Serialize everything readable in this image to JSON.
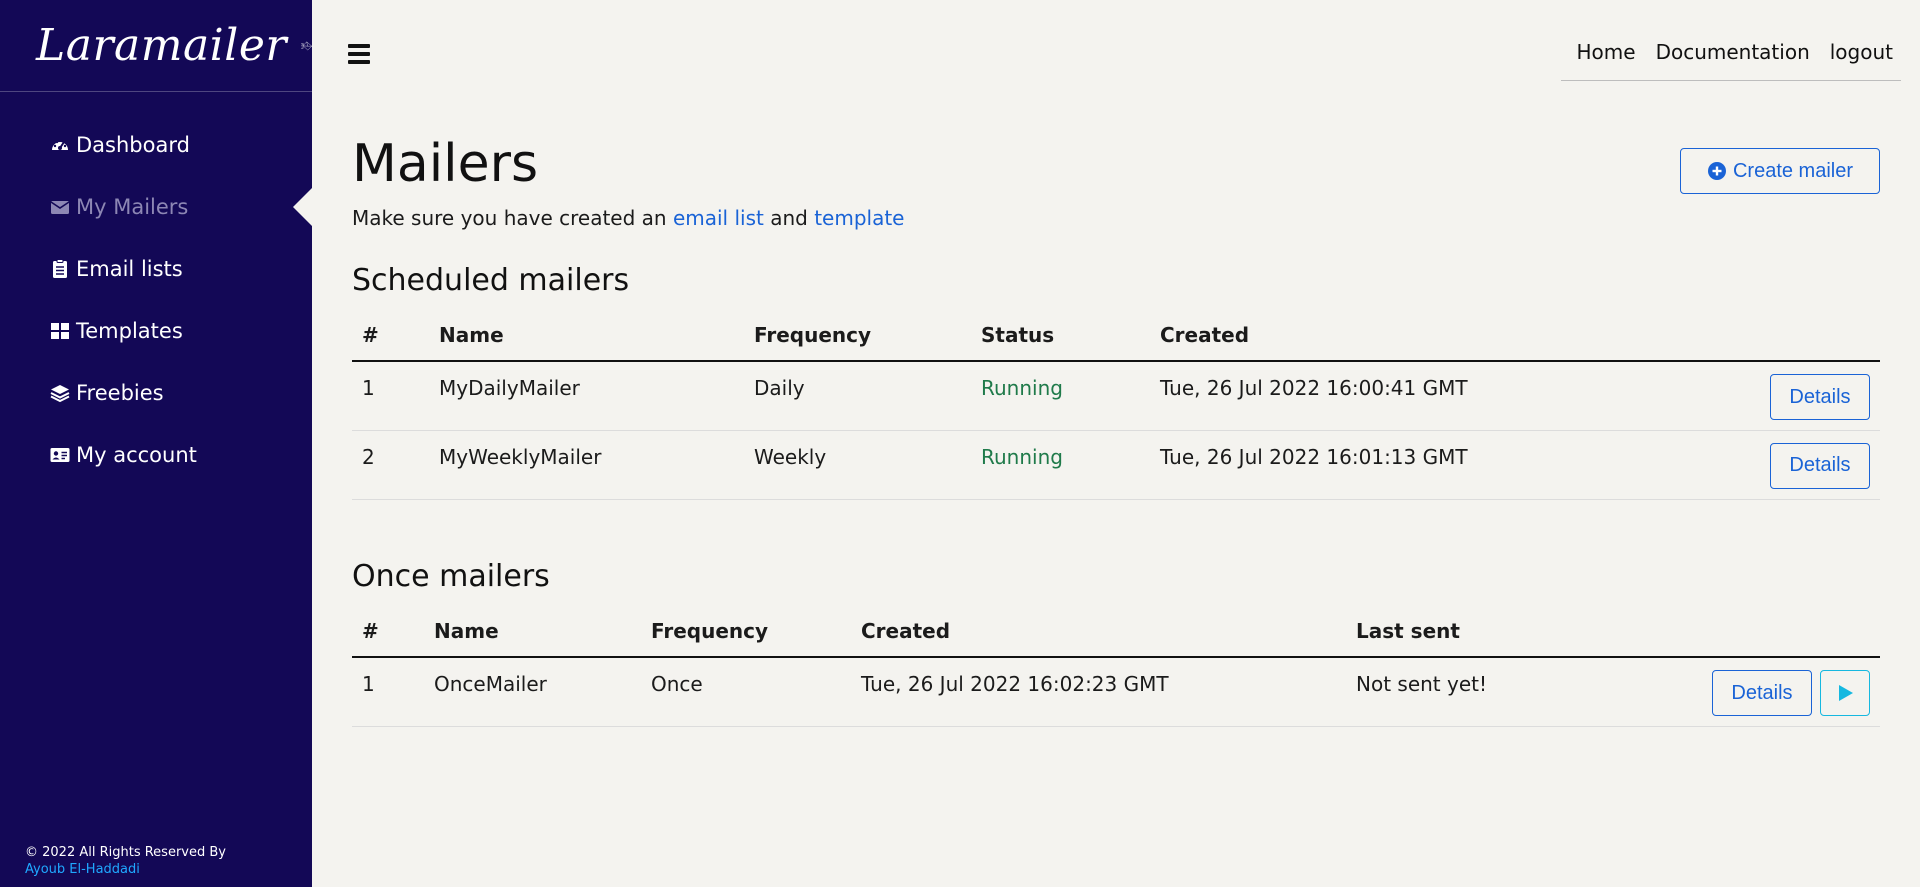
{
  "brand": {
    "name": "Laramailer",
    "logo_icon": "envelope-logo-icon"
  },
  "sidebar": {
    "items": [
      {
        "label": "Dashboard",
        "icon": "dashboard-icon"
      },
      {
        "label": "My Mailers",
        "icon": "envelope-icon",
        "active": true
      },
      {
        "label": "Email lists",
        "icon": "clipboard-list-icon"
      },
      {
        "label": "Templates",
        "icon": "grid-icon"
      },
      {
        "label": "Freebies",
        "icon": "layers-icon"
      },
      {
        "label": "My account",
        "icon": "id-card-icon"
      }
    ],
    "footer": {
      "copyright": "© 2022 All Rights Reserved By",
      "author": "Ayoub El-Haddadi"
    }
  },
  "topnav": {
    "home": "Home",
    "documentation": "Documentation",
    "logout": "logout"
  },
  "page": {
    "title": "Mailers",
    "create_button": "Create mailer",
    "subtitle_prefix": "Make sure you have created an ",
    "subtitle_link1": "email list",
    "subtitle_mid": " and ",
    "subtitle_link2": "template"
  },
  "scheduled": {
    "title": "Scheduled mailers",
    "headers": [
      "#",
      "Name",
      "Frequency",
      "Status",
      "Created"
    ],
    "rows": [
      {
        "num": "1",
        "name": "MyDailyMailer",
        "frequency": "Daily",
        "status": "Running",
        "created": "Tue, 26 Jul 2022 16:00:41 GMT",
        "action": "Details"
      },
      {
        "num": "2",
        "name": "MyWeeklyMailer",
        "frequency": "Weekly",
        "status": "Running",
        "created": "Tue, 26 Jul 2022 16:01:13 GMT",
        "action": "Details"
      }
    ]
  },
  "once": {
    "title": "Once mailers",
    "headers": [
      "#",
      "Name",
      "Frequency",
      "Created",
      "Last sent"
    ],
    "rows": [
      {
        "num": "1",
        "name": "OnceMailer",
        "frequency": "Once",
        "created": "Tue, 26 Jul 2022 16:02:23 GMT",
        "last_sent": "Not sent yet!",
        "action": "Details"
      }
    ]
  },
  "colors": {
    "sidebar_bg": "#130856",
    "page_bg": "#f4f3ef",
    "accent": "#1a63d6",
    "status_running": "#1f7a4a",
    "play": "#16b8e0",
    "footer_author": "#1fa8ff"
  }
}
